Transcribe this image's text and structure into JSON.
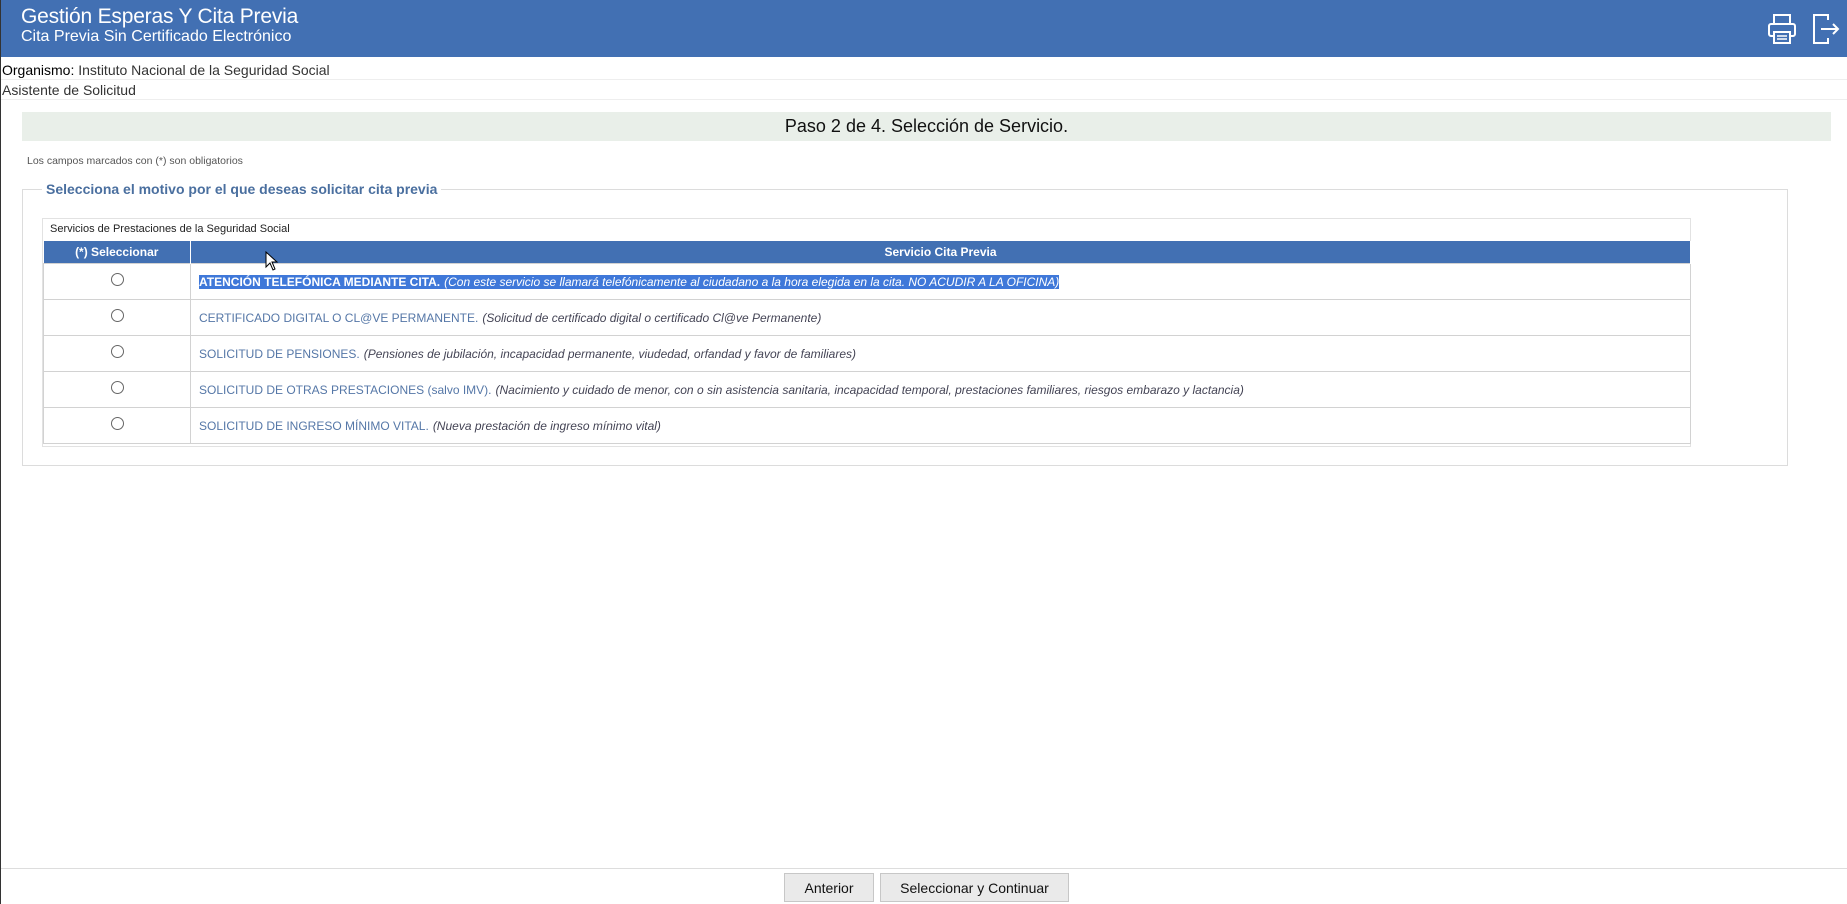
{
  "header": {
    "title": "Gestión Esperas Y Cita Previa",
    "subtitle": "Cita Previa Sin Certificado Electrónico",
    "icons": [
      "printer-icon",
      "logout-icon"
    ]
  },
  "organismo": {
    "label": "Organismo:",
    "value": "Instituto Nacional de la Seguridad Social"
  },
  "wizard_label": "Asistente de Solicitud",
  "step_title": "Paso 2 de 4. Selección de Servicio.",
  "required_note": "Los campos marcados con (*) son obligatorios",
  "fieldset_legend": "Selecciona el motivo por el que deseas solicitar cita previa",
  "table": {
    "caption": "Servicios de Prestaciones de la Seguridad Social",
    "col_select": "(*) Seleccionar",
    "col_service": "Servicio Cita Previa",
    "rows": [
      {
        "name": "ATENCIÓN TELEFÓNICA MEDIANTE CITA.",
        "desc": "(Con este servicio se llamará telefónicamente al ciudadano a la hora elegida en la cita. NO ACUDIR A LA OFICINA)"
      },
      {
        "name": "CERTIFICADO DIGITAL O CL@VE PERMANENTE.",
        "desc": "(Solicitud de certificado digital o certificado Cl@ve Permanente)"
      },
      {
        "name": "SOLICITUD DE PENSIONES.",
        "desc": "(Pensiones de jubilación, incapacidad permanente, viudedad, orfandad y favor de familiares)"
      },
      {
        "name": "SOLICITUD DE OTRAS PRESTACIONES (salvo IMV).",
        "desc": "(Nacimiento y cuidado de menor, con o sin asistencia sanitaria, incapacidad temporal, prestaciones familiares, riesgos embarazo y lactancia)"
      },
      {
        "name": "SOLICITUD DE INGRESO MÍNIMO VITAL.",
        "desc": "(Nueva prestación de ingreso mínimo vital)"
      }
    ]
  },
  "buttons": {
    "back": "Anterior",
    "continue": "Seleccionar y Continuar"
  },
  "colors": {
    "header_bg": "#4270b3",
    "step_bar_bg": "#e9efe9",
    "selection_highlight": "#3f78d9"
  }
}
